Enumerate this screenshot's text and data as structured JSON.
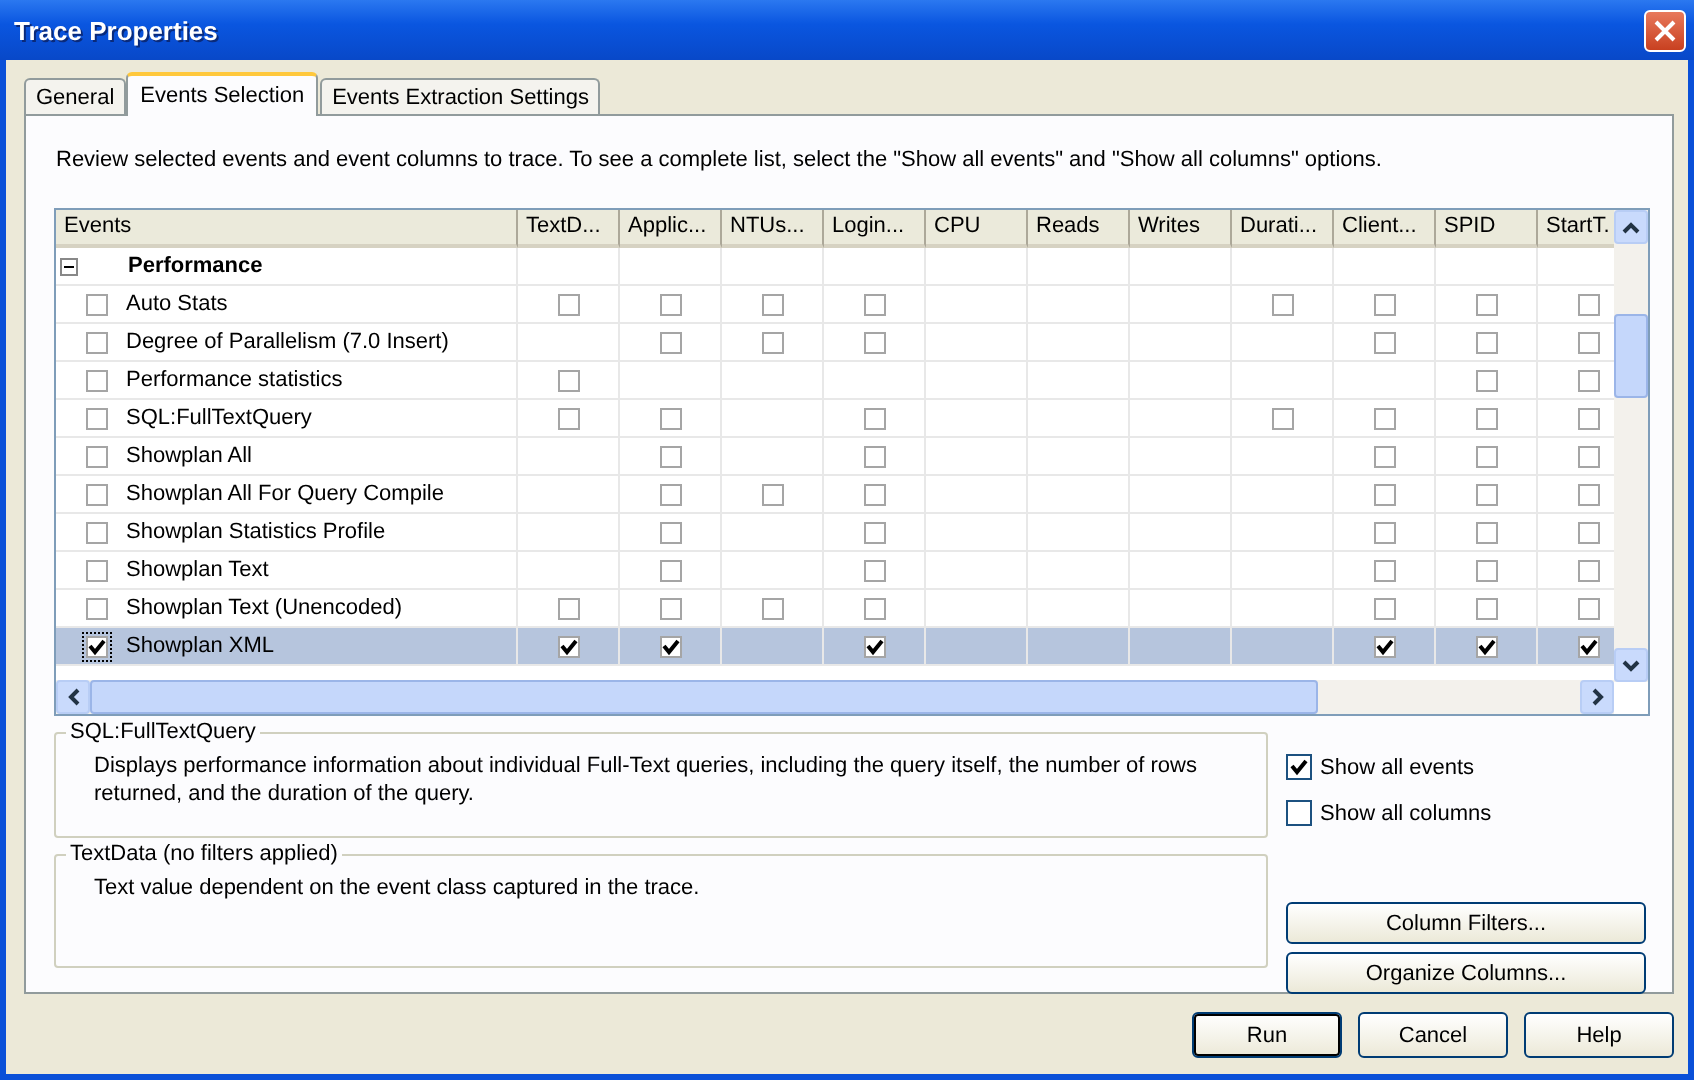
{
  "window": {
    "title": "Trace Properties"
  },
  "tabs": [
    {
      "label": "General",
      "selected": false
    },
    {
      "label": "Events Selection",
      "selected": true
    },
    {
      "label": "Events Extraction Settings",
      "selected": false
    }
  ],
  "instructions": "Review selected events and event columns to trace. To see a complete list, select the \"Show all events\" and \"Show all columns\" options.",
  "grid": {
    "columns": [
      "Events",
      "TextD...",
      "Applic...",
      "NTUs...",
      "Login...",
      "CPU",
      "Reads",
      "Writes",
      "Durati...",
      "Client...",
      "SPID",
      "StartT."
    ],
    "group": {
      "label": "Performance",
      "expanded": true
    },
    "rows": [
      {
        "name": "Auto Stats",
        "checked": false,
        "selected": false,
        "cells": [
          {
            "kind": "checkbox",
            "checked": false
          },
          {
            "kind": "checkbox",
            "checked": false
          },
          {
            "kind": "checkbox",
            "checked": false
          },
          {
            "kind": "checkbox",
            "checked": false
          },
          {
            "kind": "blank"
          },
          {
            "kind": "blank"
          },
          {
            "kind": "blank"
          },
          {
            "kind": "checkbox",
            "checked": false
          },
          {
            "kind": "checkbox",
            "checked": false
          },
          {
            "kind": "checkbox",
            "checked": false
          },
          {
            "kind": "checkbox",
            "checked": false
          }
        ]
      },
      {
        "name": "Degree of Parallelism (7.0 Insert)",
        "checked": false,
        "selected": false,
        "cells": [
          {
            "kind": "blank"
          },
          {
            "kind": "checkbox",
            "checked": false
          },
          {
            "kind": "checkbox",
            "checked": false
          },
          {
            "kind": "checkbox",
            "checked": false
          },
          {
            "kind": "blank"
          },
          {
            "kind": "blank"
          },
          {
            "kind": "blank"
          },
          {
            "kind": "blank"
          },
          {
            "kind": "checkbox",
            "checked": false
          },
          {
            "kind": "checkbox",
            "checked": false
          },
          {
            "kind": "checkbox",
            "checked": false
          }
        ]
      },
      {
        "name": "Performance statistics",
        "checked": false,
        "selected": false,
        "cells": [
          {
            "kind": "checkbox",
            "checked": false
          },
          {
            "kind": "blank"
          },
          {
            "kind": "blank"
          },
          {
            "kind": "blank"
          },
          {
            "kind": "blank"
          },
          {
            "kind": "blank"
          },
          {
            "kind": "blank"
          },
          {
            "kind": "blank"
          },
          {
            "kind": "blank"
          },
          {
            "kind": "checkbox",
            "checked": false
          },
          {
            "kind": "checkbox",
            "checked": false
          }
        ]
      },
      {
        "name": "SQL:FullTextQuery",
        "checked": false,
        "selected": false,
        "cells": [
          {
            "kind": "checkbox",
            "checked": false
          },
          {
            "kind": "checkbox",
            "checked": false
          },
          {
            "kind": "blank"
          },
          {
            "kind": "checkbox",
            "checked": false
          },
          {
            "kind": "blank"
          },
          {
            "kind": "blank"
          },
          {
            "kind": "blank"
          },
          {
            "kind": "checkbox",
            "checked": false
          },
          {
            "kind": "checkbox",
            "checked": false
          },
          {
            "kind": "checkbox",
            "checked": false
          },
          {
            "kind": "checkbox",
            "checked": false
          }
        ]
      },
      {
        "name": "Showplan All",
        "checked": false,
        "selected": false,
        "cells": [
          {
            "kind": "blank"
          },
          {
            "kind": "checkbox",
            "checked": false
          },
          {
            "kind": "blank"
          },
          {
            "kind": "checkbox",
            "checked": false
          },
          {
            "kind": "blank"
          },
          {
            "kind": "blank"
          },
          {
            "kind": "blank"
          },
          {
            "kind": "blank"
          },
          {
            "kind": "checkbox",
            "checked": false
          },
          {
            "kind": "checkbox",
            "checked": false
          },
          {
            "kind": "checkbox",
            "checked": false
          }
        ]
      },
      {
        "name": "Showplan All For Query Compile",
        "checked": false,
        "selected": false,
        "cells": [
          {
            "kind": "blank"
          },
          {
            "kind": "checkbox",
            "checked": false
          },
          {
            "kind": "checkbox",
            "checked": false
          },
          {
            "kind": "checkbox",
            "checked": false
          },
          {
            "kind": "blank"
          },
          {
            "kind": "blank"
          },
          {
            "kind": "blank"
          },
          {
            "kind": "blank"
          },
          {
            "kind": "checkbox",
            "checked": false
          },
          {
            "kind": "checkbox",
            "checked": false
          },
          {
            "kind": "checkbox",
            "checked": false
          }
        ]
      },
      {
        "name": "Showplan Statistics Profile",
        "checked": false,
        "selected": false,
        "cells": [
          {
            "kind": "blank"
          },
          {
            "kind": "checkbox",
            "checked": false
          },
          {
            "kind": "blank"
          },
          {
            "kind": "checkbox",
            "checked": false
          },
          {
            "kind": "blank"
          },
          {
            "kind": "blank"
          },
          {
            "kind": "blank"
          },
          {
            "kind": "blank"
          },
          {
            "kind": "checkbox",
            "checked": false
          },
          {
            "kind": "checkbox",
            "checked": false
          },
          {
            "kind": "checkbox",
            "checked": false
          }
        ]
      },
      {
        "name": "Showplan Text",
        "checked": false,
        "selected": false,
        "cells": [
          {
            "kind": "blank"
          },
          {
            "kind": "checkbox",
            "checked": false
          },
          {
            "kind": "blank"
          },
          {
            "kind": "checkbox",
            "checked": false
          },
          {
            "kind": "blank"
          },
          {
            "kind": "blank"
          },
          {
            "kind": "blank"
          },
          {
            "kind": "blank"
          },
          {
            "kind": "checkbox",
            "checked": false
          },
          {
            "kind": "checkbox",
            "checked": false
          },
          {
            "kind": "checkbox",
            "checked": false
          }
        ]
      },
      {
        "name": "Showplan Text (Unencoded)",
        "checked": false,
        "selected": false,
        "cells": [
          {
            "kind": "checkbox",
            "checked": false
          },
          {
            "kind": "checkbox",
            "checked": false
          },
          {
            "kind": "checkbox",
            "checked": false
          },
          {
            "kind": "checkbox",
            "checked": false
          },
          {
            "kind": "blank"
          },
          {
            "kind": "blank"
          },
          {
            "kind": "blank"
          },
          {
            "kind": "blank"
          },
          {
            "kind": "checkbox",
            "checked": false
          },
          {
            "kind": "checkbox",
            "checked": false
          },
          {
            "kind": "checkbox",
            "checked": false
          }
        ]
      },
      {
        "name": "Showplan XML",
        "checked": true,
        "selected": true,
        "cells": [
          {
            "kind": "checkbox",
            "checked": true
          },
          {
            "kind": "checkbox",
            "checked": true
          },
          {
            "kind": "blank"
          },
          {
            "kind": "checkbox",
            "checked": true
          },
          {
            "kind": "blank"
          },
          {
            "kind": "blank"
          },
          {
            "kind": "blank"
          },
          {
            "kind": "blank"
          },
          {
            "kind": "checkbox",
            "checked": true
          },
          {
            "kind": "checkbox",
            "checked": true
          },
          {
            "kind": "checkbox",
            "checked": true
          }
        ]
      }
    ]
  },
  "description": {
    "title": "SQL:FullTextQuery",
    "text": "Displays performance information about individual Full-Text queries, including the query itself, the number of rows returned, and the duration of the query."
  },
  "options": [
    {
      "label": "Show all events",
      "checked": true
    },
    {
      "label": "Show all columns",
      "checked": false
    }
  ],
  "column_info": {
    "title": "TextData (no filters applied)",
    "text": "Text value dependent on the event class captured in the trace."
  },
  "side_buttons": [
    "Column Filters...",
    "Organize Columns..."
  ],
  "buttons": [
    {
      "label": "Run",
      "default": true
    },
    {
      "label": "Cancel",
      "default": false
    },
    {
      "label": "Help",
      "default": false
    }
  ]
}
